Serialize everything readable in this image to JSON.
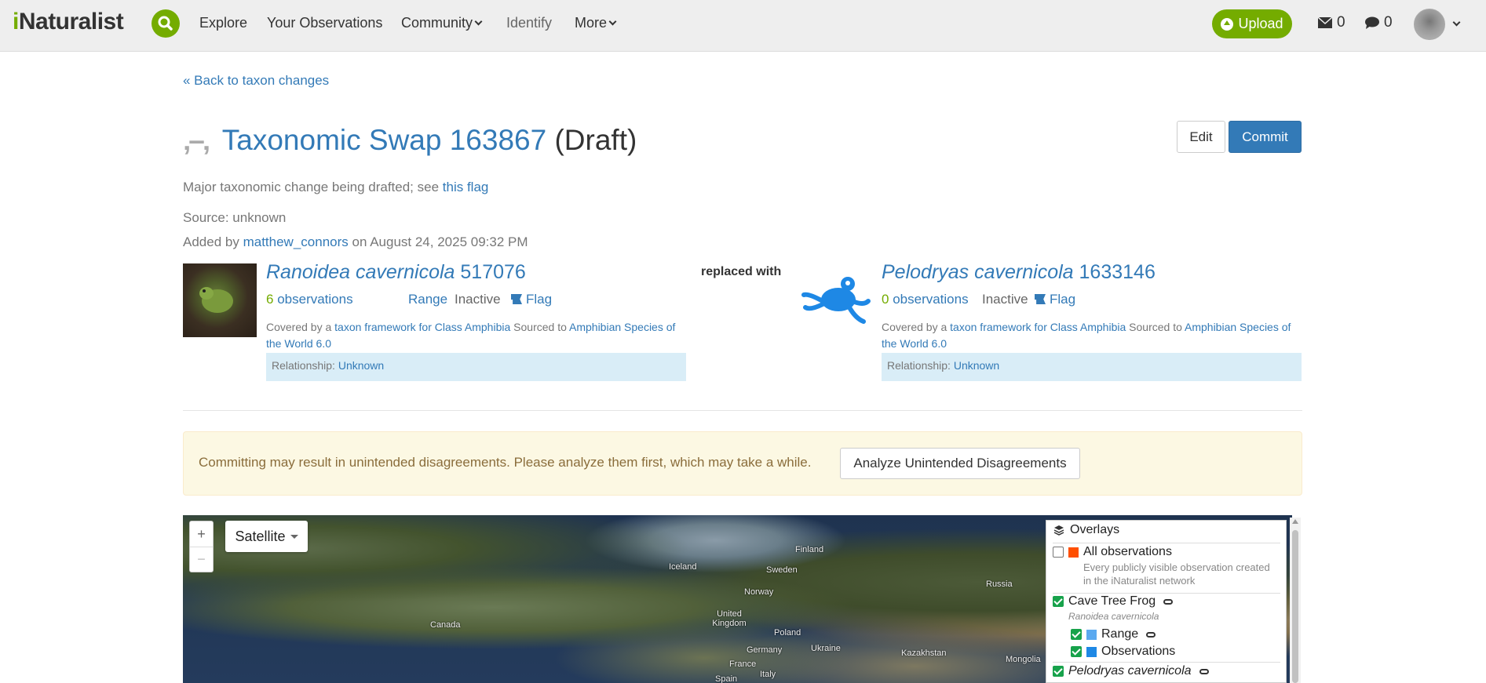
{
  "header": {
    "logo": "iNaturalist",
    "nav": {
      "explore": "Explore",
      "your_observations": "Your Observations",
      "community": "Community",
      "identify": "Identify",
      "more": "More"
    },
    "upload_label": "Upload",
    "messages_count": "0",
    "comments_count": "0"
  },
  "back_link": "« Back to taxon changes",
  "title": {
    "name": "Taxonomic Swap 163867",
    "status": "(Draft)"
  },
  "actions": {
    "edit": "Edit",
    "commit": "Commit"
  },
  "description": {
    "text": "Major taxonomic change being drafted; see",
    "link": "this flag"
  },
  "source": "Source: unknown",
  "added_by": {
    "prefix": "Added by",
    "user": "matthew_connors",
    "suffix": "on August 24, 2025 09:32 PM"
  },
  "replaced_with": "replaced with",
  "input_taxon": {
    "name": "Ranoidea cavernicola",
    "id": "517076",
    "obs_count": "6",
    "obs_label": "observations",
    "range": "Range",
    "status": "Inactive",
    "flag": "Flag",
    "covered_prefix": "Covered by a",
    "framework": "taxon framework for Class Amphibia",
    "sourced_to": "Sourced to",
    "source": "Amphibian Species of the World 6.0",
    "relationship_label": "Relationship:",
    "relationship": "Unknown"
  },
  "output_taxon": {
    "name": "Pelodryas cavernicola",
    "id": "1633146",
    "obs_count": "0",
    "obs_label": "observations",
    "status": "Inactive",
    "flag": "Flag",
    "covered_prefix": "Covered by a",
    "framework": "taxon framework for Class Amphibia",
    "sourced_to": "Sourced to",
    "source": "Amphibian Species of the World 6.0",
    "relationship_label": "Relationship:",
    "relationship": "Unknown"
  },
  "warning": {
    "text": "Committing may result in unintended disagreements. Please analyze them first, which may take a while.",
    "button": "Analyze Unintended Disagreements"
  },
  "map": {
    "zoom_in": "+",
    "zoom_out": "−",
    "layer": "Satellite",
    "labels": [
      "Finland",
      "Iceland",
      "Sweden",
      "Norway",
      "Russia",
      "Canada",
      "United Kingdom",
      "Poland",
      "Ukraine",
      "Germany",
      "France",
      "Italy",
      "Spain",
      "Kazakhstan",
      "Mongolia"
    ],
    "overlays": {
      "title": "Overlays",
      "all_obs": "All observations",
      "all_obs_desc": "Every publicly visible observation created in the iNaturalist network",
      "taxon1_common": "Cave Tree Frog",
      "taxon1_sci": "Ranoidea cavernicola",
      "range": "Range",
      "observations": "Observations",
      "taxon2_sci": "Pelodryas cavernicola"
    }
  },
  "colors": {
    "brand_green": "#74ac00",
    "link_blue": "#337ab7",
    "all_obs_swatch": "#ff4f00",
    "range_swatch": "#5aa9f0",
    "obs_swatch": "#1e88e5",
    "check_green": "#17a24b"
  }
}
